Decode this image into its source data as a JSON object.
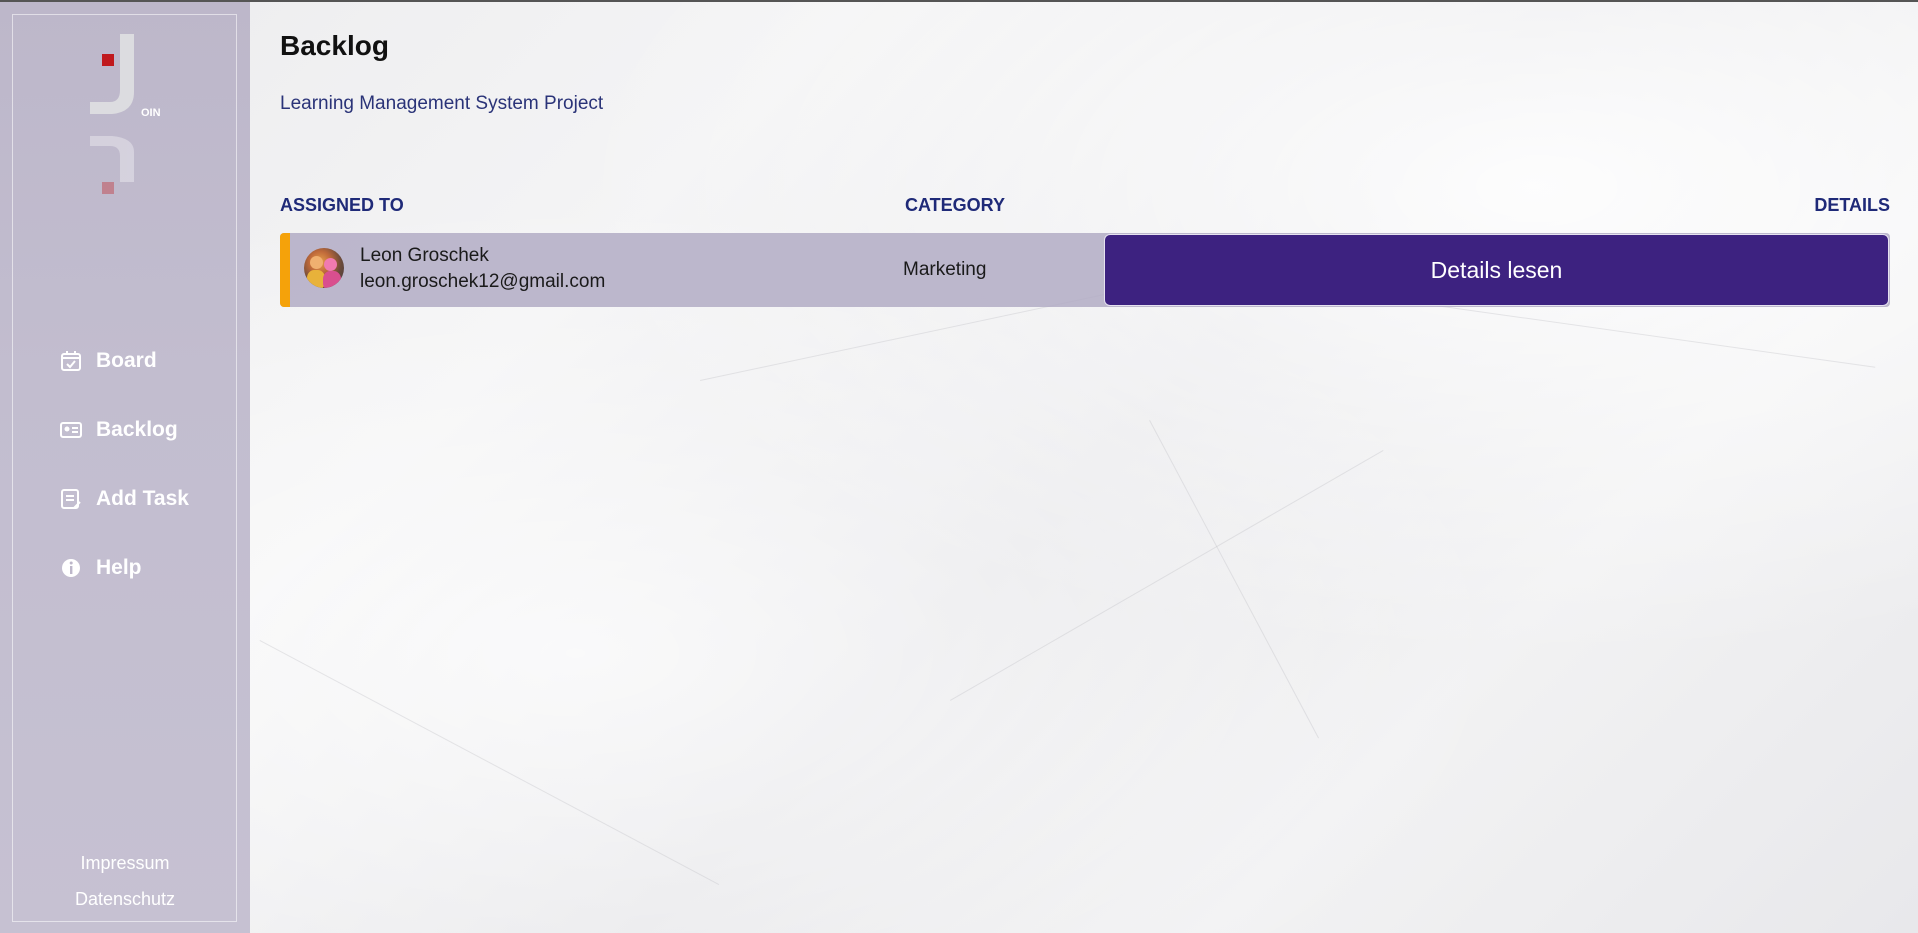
{
  "sidebar": {
    "logo_text": "OIN",
    "nav": [
      {
        "label": "Board",
        "icon": "board-icon"
      },
      {
        "label": "Backlog",
        "icon": "backlog-icon"
      },
      {
        "label": "Add Task",
        "icon": "add-task-icon"
      },
      {
        "label": "Help",
        "icon": "info-icon"
      }
    ],
    "footer": [
      "Impressum",
      "Datenschutz"
    ]
  },
  "page": {
    "title": "Backlog",
    "project": "Learning Management System Project"
  },
  "table": {
    "headers": {
      "assigned_to": "ASSIGNED TO",
      "category": "CATEGORY",
      "details": "DETAILS"
    },
    "rows": [
      {
        "name": "Leon Groschek",
        "email": "leon.groschek12@gmail.com",
        "category": "Marketing",
        "details_button": "Details lesen",
        "accent_color": "#f5a20a"
      }
    ]
  },
  "colors": {
    "sidebar_bg": "#bdb7ca",
    "header_text": "#1f2a78",
    "button_bg": "#3d2280"
  }
}
